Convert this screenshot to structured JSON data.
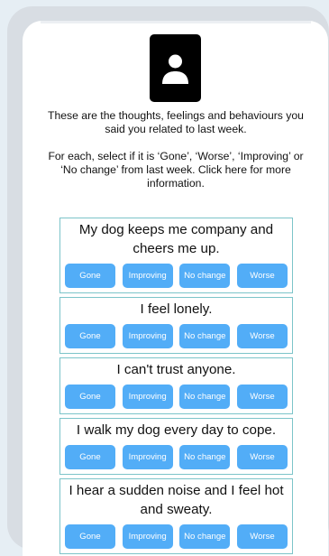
{
  "intro": {
    "line1": "These are the thoughts, feelings and behaviours you said you related to last week.",
    "line2": "For each, select if it is ‘Gone’, ‘Worse’, ‘Improving’ or ‘No change’ from last week. Click here for more information."
  },
  "icons": {
    "avatar": "person-icon"
  },
  "buttons": {
    "gone": "Gone",
    "improving": "Improving",
    "no_change": "No change",
    "worse": "Worse"
  },
  "items": [
    {
      "text": "My dog keeps me company and cheers me up."
    },
    {
      "text": "I feel lonely."
    },
    {
      "text": "I can't trust anyone."
    },
    {
      "text": "I walk my dog every day to cope."
    },
    {
      "text": "I hear a sudden noise and I feel hot and sweaty."
    }
  ],
  "colors": {
    "button": "#52adf7",
    "card_border": "#7cc4c9",
    "background": "#e6eef4"
  }
}
